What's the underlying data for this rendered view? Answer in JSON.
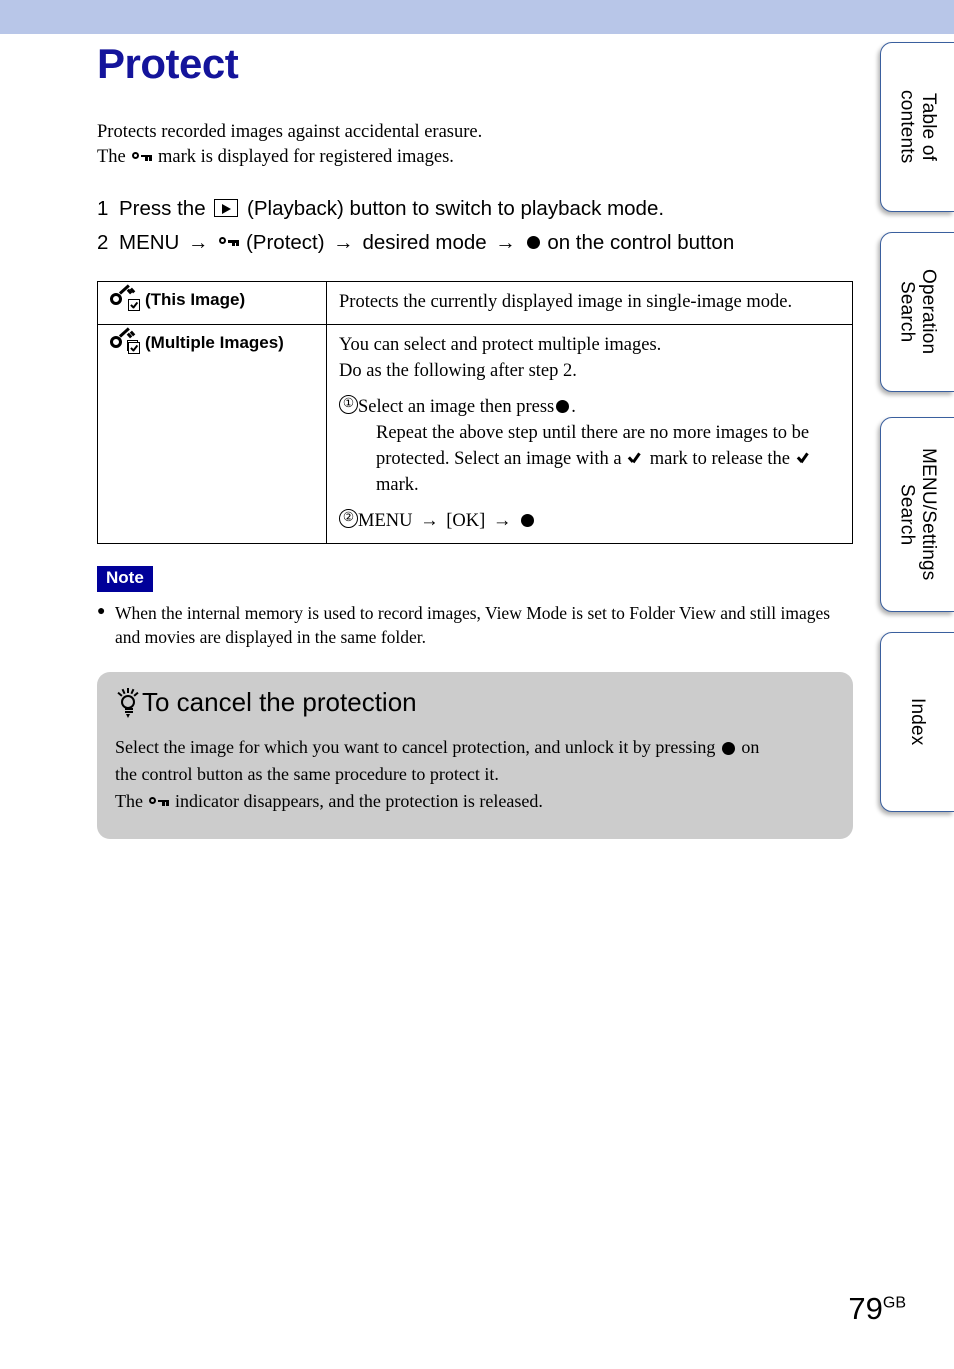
{
  "page": {
    "title": "Protect",
    "number": "79",
    "number_suffix": "GB"
  },
  "intro": {
    "line1": "Protects recorded images against accidental erasure.",
    "line2_before": "The",
    "line2_after": "mark is displayed for registered images."
  },
  "steps": [
    {
      "num": "1",
      "before": "Press the",
      "after": "(Playback) button to switch to playback mode."
    },
    {
      "num": "2",
      "part1": "MENU",
      "part2": "(Protect)",
      "part3": "desired mode",
      "part4": "on the control button",
      "arrow": "→"
    }
  ],
  "table": {
    "rows": [
      {
        "mode_label": "(This Image)",
        "icon": "key-single-checkbox-icon",
        "desc_lines": [
          "Protects the currently displayed image in single-image mode."
        ]
      },
      {
        "mode_label": "(Multiple Images)",
        "icon": "key-multiple-checkbox-icon",
        "desc_lines": [
          "You can select and protect multiple images.",
          "Do as the following after step 2."
        ],
        "substeps": [
          {
            "num": "①",
            "text_before": "Select an image then press",
            "text_after": ".",
            "detail_a": "Repeat the above step until there are no more images to be",
            "detail_b_1": "protected. Select an image with a",
            "detail_b_2": "mark to release the",
            "detail_c": "mark."
          },
          {
            "num": "②",
            "text_1": "MENU",
            "text_2": "[OK]",
            "arrow": "→"
          }
        ]
      }
    ]
  },
  "note": {
    "badge": "Note",
    "items": [
      "When the internal memory is used to record images, View Mode is set to Folder View and still images and movies are displayed in the same folder."
    ]
  },
  "tip": {
    "heading": "To cancel the protection",
    "icon": "lightbulb-icon",
    "line1_before": "Select the image for which you want to cancel protection, and unlock it by pressing",
    "line1_after": "on",
    "line2": "the control button as the same procedure to protect it.",
    "line3_before": "The",
    "line3_after": "indicator disappears, and the protection is released."
  },
  "side_tabs": [
    {
      "label": "Table of\ncontents",
      "name": "table-of-contents"
    },
    {
      "label": "Operation\nSearch",
      "name": "operation-search"
    },
    {
      "label": "MENU/Settings\nSearch",
      "name": "menu-settings-search"
    },
    {
      "label": "Index",
      "name": "index"
    }
  ],
  "colors": {
    "banner": "#b8c6e8",
    "title": "#14149b",
    "note_badge": "#000099",
    "tip_box": "#cccccc",
    "tab_border": "#3a5f9e"
  }
}
